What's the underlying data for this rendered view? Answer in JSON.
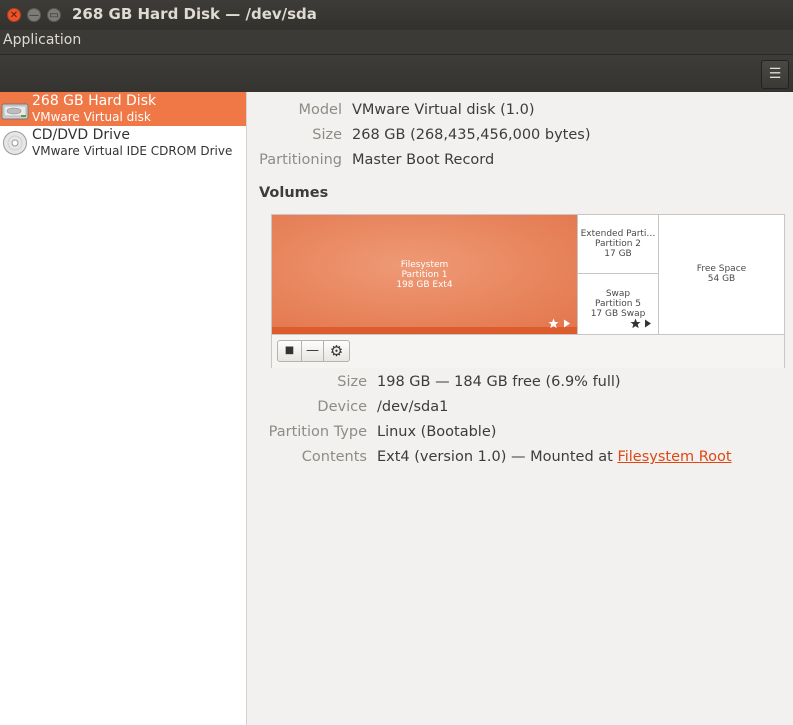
{
  "window": {
    "title": "268 GB Hard Disk — /dev/sda",
    "close_glyph": "✕",
    "min_glyph": "—",
    "max_glyph": "▭"
  },
  "menubar": {
    "application": "Application"
  },
  "toolbar": {
    "menu_glyph": "☰",
    "menu_icon": "hamburger-menu-icon"
  },
  "sidebar": {
    "devices": [
      {
        "name": "268 GB Hard Disk",
        "subtitle": "VMware Virtual disk",
        "icon": "hard-disk-icon",
        "selected": true
      },
      {
        "name": "CD/DVD Drive",
        "subtitle": "VMware Virtual IDE CDROM Drive",
        "icon": "optical-disc-icon",
        "selected": false
      }
    ]
  },
  "drive": {
    "model_label": "Model",
    "model_value": "VMware Virtual disk (1.0)",
    "size_label": "Size",
    "size_value": "268 GB (268,435,456,000 bytes)",
    "partitioning_label": "Partitioning",
    "partitioning_value": "Master Boot Record"
  },
  "volumes": {
    "heading": "Volumes",
    "segments": [
      {
        "line1": "Filesystem",
        "line2": "Partition 1",
        "line3": "198 GB Ext4"
      },
      {
        "line1": "Extended Parti…",
        "line2": "Partition 2",
        "line3": "17 GB"
      },
      {
        "line1": "Swap",
        "line2": "Partition 5",
        "line3": "17 GB Swap"
      },
      {
        "line1": "Free Space",
        "line2": "54 GB"
      }
    ],
    "toolbar": {
      "stop_glyph": "■",
      "remove_glyph": "—",
      "settings_glyph": "⚙"
    }
  },
  "partition": {
    "size_label": "Size",
    "size_value": "198 GB — 184 GB free (6.9% full)",
    "device_label": "Device",
    "device_value": "/dev/sda1",
    "type_label": "Partition Type",
    "type_value": "Linux (Bootable)",
    "contents_label": "Contents",
    "contents_value": "Ext4 (version 1.0) — Mounted at ",
    "contents_link": "Filesystem Root"
  },
  "colors": {
    "accent": "#f07746",
    "title_bar": "#3b3a36",
    "link": "#dd4814"
  }
}
